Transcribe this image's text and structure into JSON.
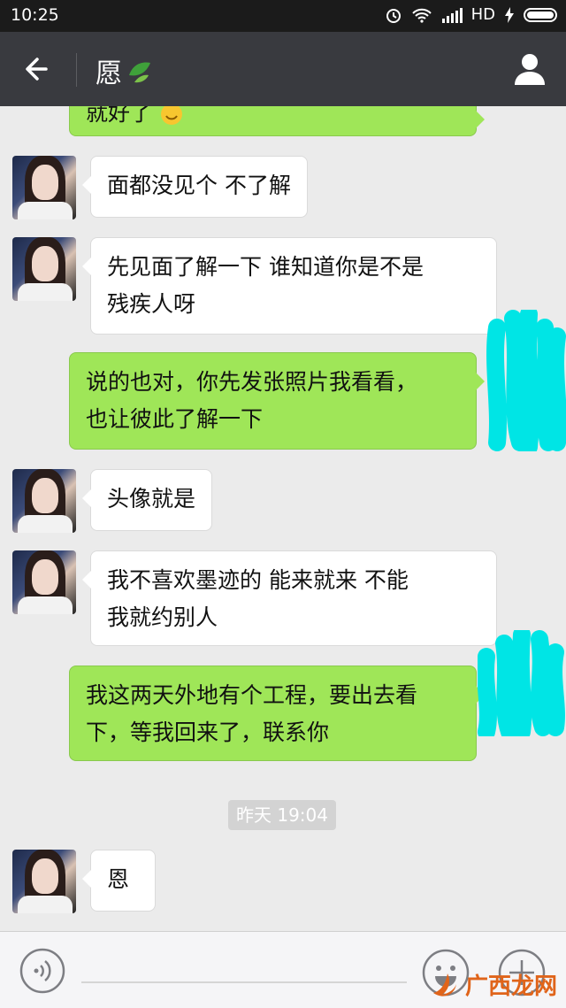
{
  "status_bar": {
    "time": "10:25",
    "network": "HD"
  },
  "header": {
    "title": "愿"
  },
  "messages": [
    {
      "side": "out",
      "text": "就好了"
    },
    {
      "side": "in",
      "text": "面都没见个  不了解"
    },
    {
      "side": "in",
      "line1": "先见面了解一下   谁知道你是不是",
      "line2": "残疾人呀"
    },
    {
      "side": "out",
      "line1": "说的也对，你先发张照片我看看，",
      "line2": "也让彼此了解一下"
    },
    {
      "side": "in",
      "text": "头像就是"
    },
    {
      "side": "in",
      "line1": "我不喜欢墨迹的   能来就来  不能",
      "line2": "我就约别人"
    },
    {
      "side": "out",
      "line1": "我这两天外地有个工程，要出去看",
      "line2": "下，等我回来了，联系你"
    },
    {
      "side": "in",
      "text": "恩"
    }
  ],
  "timestamp": "昨天 19:04",
  "watermark": "广西龙网",
  "colors": {
    "outgoing_bubble": "#9fe658",
    "incoming_bubble": "#ffffff",
    "nav_bar": "#393a3f",
    "scribble": "#00e5e5"
  }
}
